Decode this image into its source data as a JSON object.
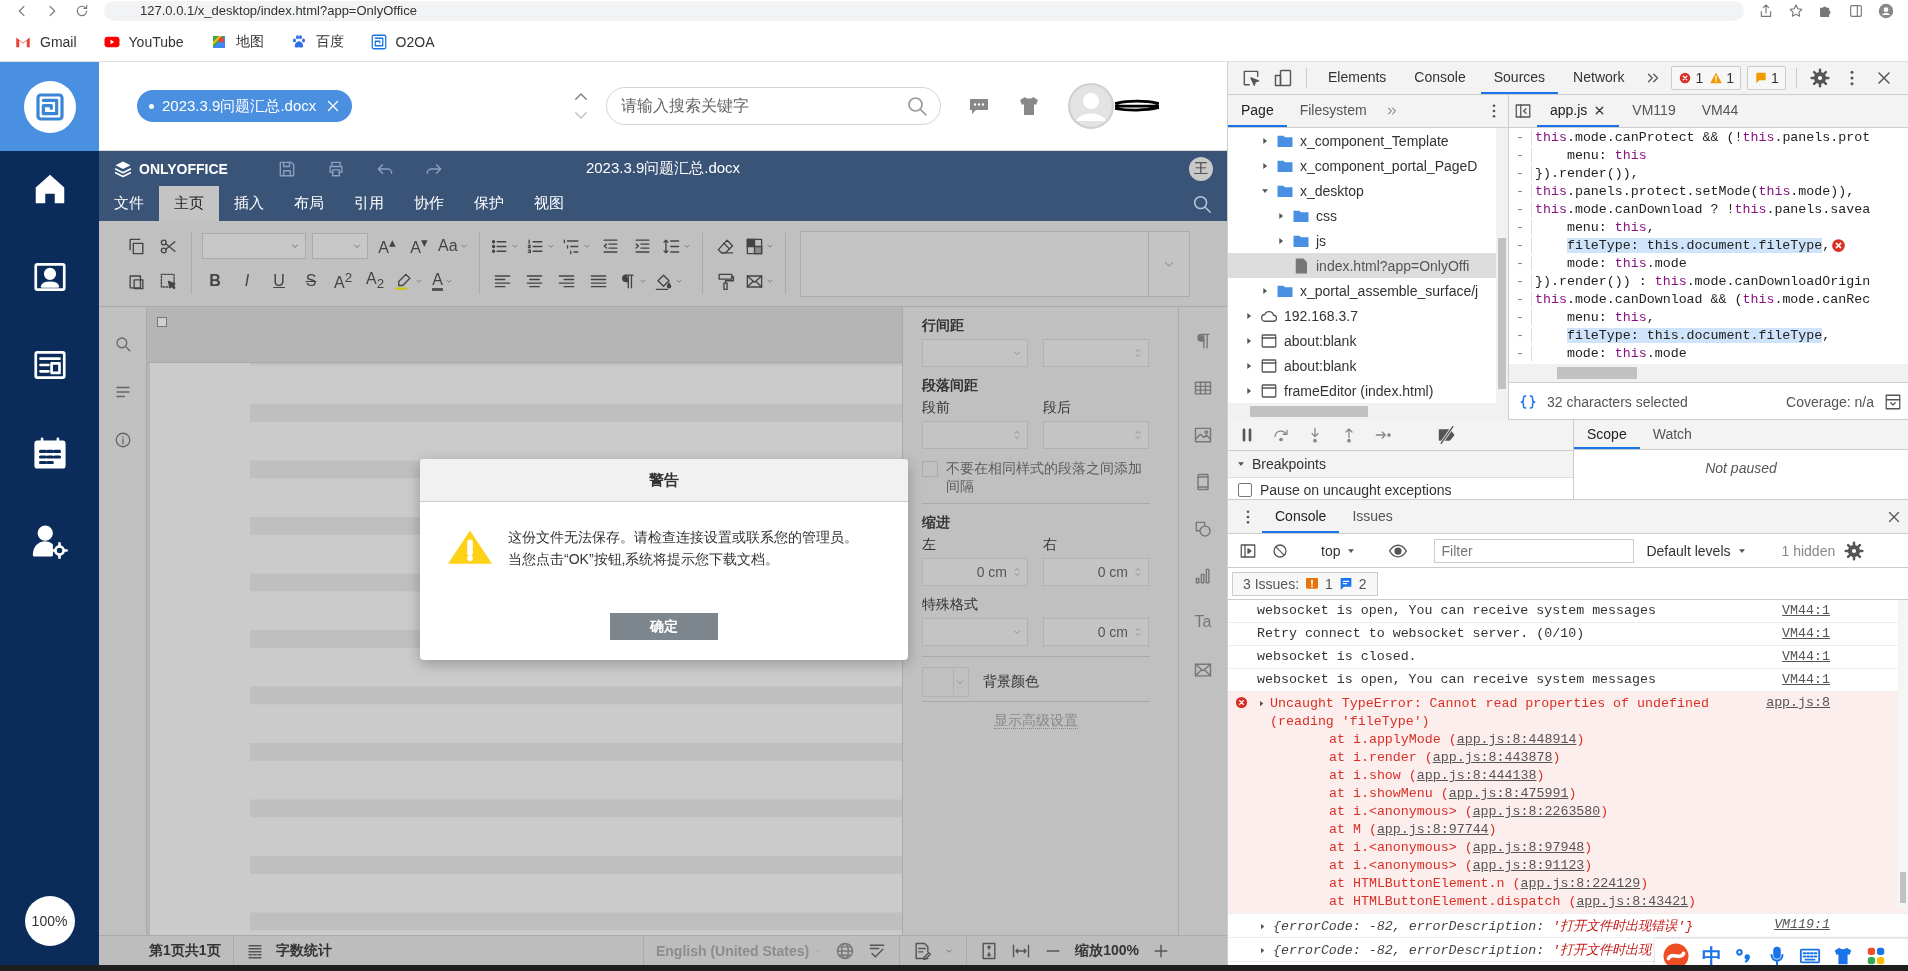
{
  "browser": {
    "url": "127.0.0.1/x_desktop/index.html?app=OnlyOffice",
    "bookmarks": [
      {
        "label": "Gmail"
      },
      {
        "label": "YouTube"
      },
      {
        "label": "地图"
      },
      {
        "label": "百度"
      },
      {
        "label": "O2OA"
      }
    ]
  },
  "app": {
    "zoom_badge": "100%",
    "open_tabs": [
      {
        "label": "2023.3.9问题汇总.docx"
      }
    ],
    "search": {
      "placeholder": "请输入搜索关键字"
    }
  },
  "editor": {
    "brand": "ONLYOFFICE",
    "title": "2023.3.9问题汇总.docx",
    "user_initial": "王",
    "tabs": [
      {
        "label": "文件",
        "selected": false
      },
      {
        "label": "主页",
        "selected": true
      },
      {
        "label": "插入",
        "selected": false
      },
      {
        "label": "布局",
        "selected": false
      },
      {
        "label": "引用",
        "selected": false
      },
      {
        "label": "协作",
        "selected": false
      },
      {
        "label": "保护",
        "selected": false
      },
      {
        "label": "视图",
        "selected": false
      }
    ],
    "glyphs": [
      {
        "text": "A$^{▴}$",
        "kind": "plain"
      },
      {
        "text": "A$^{▾}$",
        "kind": "plain"
      },
      {
        "text": "Aa",
        "kind": "plain"
      },
      {
        "text": "B",
        "kind": "bold"
      },
      {
        "text": "I",
        "kind": "italic"
      },
      {
        "text": "U",
        "kind": "underline"
      },
      {
        "text": "S",
        "kind": "strike"
      },
      {
        "text": "A$^{2}$",
        "kind": "plain"
      },
      {
        "text": "A$_{2}$",
        "kind": "plain"
      },
      {
        "text": "A",
        "kind": "color"
      }
    ],
    "right_bar": {
      "glyph": "Ta"
    },
    "settings": [
      {
        "kind": "heading",
        "text": "行间距"
      },
      {
        "kind": "fields",
        "items": [
          {
            "kind": "select"
          },
          {
            "kind": "spin"
          }
        ]
      },
      {
        "kind": "heading",
        "text": "段落间距"
      },
      {
        "kind": "labels",
        "items": [
          "段前",
          "段后"
        ]
      },
      {
        "kind": "fields",
        "items": [
          {
            "kind": "spin"
          },
          {
            "kind": "spin"
          }
        ]
      },
      {
        "kind": "checkbox",
        "text": "不要在相同样式的段落之间添加间隔",
        "checked": false,
        "disabled": true
      },
      {
        "kind": "divider"
      },
      {
        "kind": "heading",
        "text": "缩进"
      },
      {
        "kind": "labels",
        "items": [
          "左",
          "右"
        ]
      },
      {
        "kind": "fields",
        "items": [
          {
            "kind": "spin",
            "value": "0 cm"
          },
          {
            "kind": "spin",
            "value": "0 cm"
          }
        ]
      },
      {
        "kind": "labels",
        "items": [
          "特殊格式"
        ]
      },
      {
        "kind": "fields",
        "items": [
          {
            "kind": "select"
          },
          {
            "kind": "spin",
            "value": "0 cm"
          }
        ]
      },
      {
        "kind": "divider"
      },
      {
        "kind": "color",
        "text": "背景颜色"
      },
      {
        "kind": "divider"
      },
      {
        "kind": "link",
        "text": "显示高级设置"
      }
    ],
    "status_bar": {
      "page_info": "第1页共1页",
      "word_count": "字数统计",
      "language": {
        "text": "English (United States)",
        "disabled": true
      },
      "zoom": "缩放100%"
    }
  },
  "dialog": {
    "title": "警告",
    "lines": [
      "这份文件无法保存。请检查连接设置或联系您的管理员。",
      "当您点击“OK”按钮,系统将提示您下载文档。"
    ],
    "button": "确定"
  },
  "devtools": {
    "tabs": [
      {
        "label": "Elements",
        "selected": false
      },
      {
        "label": "Console",
        "selected": false
      },
      {
        "label": "Sources",
        "selected": true
      },
      {
        "label": "Network",
        "selected": false
      }
    ],
    "counters": [
      {
        "kind": "error",
        "count": "1"
      },
      {
        "kind": "warning",
        "count": "1"
      },
      {
        "kind": "issue",
        "count": "1"
      }
    ],
    "navigator_tabs": [
      {
        "label": "Page",
        "selected": true
      },
      {
        "label": "Filesystem",
        "selected": false
      }
    ],
    "tree": [
      {
        "kind": "group",
        "children": [
          {
            "label": "x_component_Template",
            "kind": "folder",
            "expanded": false,
            "selected": false
          },
          {
            "label": "x_component_portal_PageD",
            "kind": "folder",
            "expanded": false,
            "selected": false
          },
          {
            "label": "x_desktop",
            "kind": "folder",
            "expanded": true,
            "selected": false,
            "children": [
              {
                "label": "css",
                "kind": "folder",
                "expanded": false,
                "selected": false
              },
              {
                "label": "js",
                "kind": "folder",
                "expanded": false,
                "selected": false
              },
              {
                "label": "index.html?app=OnlyOffi",
                "kind": "file",
                "selected": true
              }
            ]
          },
          {
            "label": "x_portal_assemble_surface/j",
            "kind": "folder",
            "expanded": false,
            "selected": false
          }
        ]
      },
      {
        "label": "192.168.3.7",
        "kind": "cloud",
        "expanded": false,
        "selected": false
      },
      {
        "label": "about:blank",
        "kind": "frame",
        "expanded": false,
        "selected": false
      },
      {
        "label": "about:blank",
        "kind": "frame",
        "expanded": false,
        "selected": false
      },
      {
        "label": "frameEditor (index.html)",
        "kind": "frame",
        "expanded": false,
        "selected": false
      }
    ],
    "editor_tabs": [
      {
        "label": "app.js",
        "selected": true,
        "closable": true
      },
      {
        "label": "VM119",
        "selected": false,
        "closable": false
      },
      {
        "label": "VM44",
        "selected": false,
        "closable": false
      }
    ],
    "code": [
      {
        "gutter": "-",
        "indented": false,
        "error": false,
        "parts": [
          {
            "text": "this",
            "kind": "keyword"
          },
          {
            "text": ".mode.canProtect && (!",
            "kind": "plain"
          },
          {
            "text": "this",
            "kind": "keyword"
          },
          {
            "text": ".panels.prot",
            "kind": "plain"
          }
        ]
      },
      {
        "gutter": "-",
        "indented": true,
        "error": false,
        "parts": [
          {
            "text": "menu: ",
            "kind": "plain"
          },
          {
            "text": "this",
            "kind": "keyword"
          }
        ]
      },
      {
        "gutter": "-",
        "indented": false,
        "error": false,
        "parts": [
          {
            "text": "}).render()),",
            "kind": "plain"
          }
        ]
      },
      {
        "gutter": "-",
        "indented": false,
        "error": false,
        "parts": [
          {
            "text": "this",
            "kind": "keyword"
          },
          {
            "text": ".panels.protect.setMode(",
            "kind": "plain"
          },
          {
            "text": "this",
            "kind": "keyword"
          },
          {
            "text": ".mode)),",
            "kind": "plain"
          }
        ]
      },
      {
        "gutter": "-",
        "indented": false,
        "error": false,
        "parts": [
          {
            "text": "this",
            "kind": "keyword"
          },
          {
            "text": ".mode.canDownload ? !",
            "kind": "plain"
          },
          {
            "text": "this",
            "kind": "keyword"
          },
          {
            "text": ".panels.savea",
            "kind": "plain"
          }
        ]
      },
      {
        "gutter": "-",
        "indented": true,
        "error": false,
        "parts": [
          {
            "text": "menu: ",
            "kind": "plain"
          },
          {
            "text": "this",
            "kind": "keyword"
          },
          {
            "text": ",",
            "kind": "plain"
          }
        ]
      },
      {
        "gutter": "-",
        "indented": true,
        "error": true,
        "parts": [
          {
            "text": "fileType: this.document.fileType",
            "kind": "marked"
          },
          {
            "text": ",",
            "kind": "plain"
          }
        ]
      },
      {
        "gutter": "-",
        "indented": true,
        "error": false,
        "parts": [
          {
            "text": "mode: ",
            "kind": "plain"
          },
          {
            "text": "this",
            "kind": "keyword"
          },
          {
            "text": ".mode",
            "kind": "plain"
          }
        ]
      },
      {
        "gutter": "-",
        "indented": false,
        "error": false,
        "parts": [
          {
            "text": "}).render()) : ",
            "kind": "plain"
          },
          {
            "text": "this",
            "kind": "keyword"
          },
          {
            "text": ".mode.canDownloadOrigin",
            "kind": "plain"
          }
        ]
      },
      {
        "gutter": "-",
        "indented": false,
        "error": false,
        "parts": [
          {
            "text": "this",
            "kind": "keyword"
          },
          {
            "text": ".mode.canDownload && (",
            "kind": "plain"
          },
          {
            "text": "this",
            "kind": "keyword"
          },
          {
            "text": ".mode.canRec",
            "kind": "plain"
          }
        ]
      },
      {
        "gutter": "-",
        "indented": true,
        "error": false,
        "parts": [
          {
            "text": "menu: ",
            "kind": "plain"
          },
          {
            "text": "this",
            "kind": "keyword"
          },
          {
            "text": ",",
            "kind": "plain"
          }
        ]
      },
      {
        "gutter": "-",
        "indented": true,
        "error": false,
        "parts": [
          {
            "text": "fileType: this.document.fileType",
            "kind": "marked"
          },
          {
            "text": ",",
            "kind": "plain"
          }
        ]
      },
      {
        "gutter": "-",
        "indented": true,
        "error": false,
        "parts": [
          {
            "text": "mode: ",
            "kind": "plain"
          },
          {
            "text": "this",
            "kind": "keyword"
          },
          {
            "text": ".mode",
            "kind": "plain"
          }
        ]
      }
    ],
    "selection_status": "32 characters selected",
    "coverage": "Coverage: n/a",
    "sidebar_tabs": [
      {
        "label": "Scope",
        "selected": true
      },
      {
        "label": "Watch",
        "selected": false
      }
    ],
    "not_paused": "Not paused",
    "breakpoints": {
      "label": "Breakpoints",
      "expanded": true
    },
    "pause_exceptions": {
      "label": "Pause on uncaught exceptions",
      "checked": false
    },
    "drawer_tabs": [
      {
        "label": "Console",
        "selected": true
      },
      {
        "label": "Issues",
        "selected": false
      }
    ],
    "context": "top",
    "filter": {
      "placeholder": "Filter"
    },
    "levels": "Default levels",
    "hidden": "1 hidden",
    "issues": {
      "label": "3 Issues:",
      "counts": [
        {
          "kind": "error",
          "count": "1"
        },
        {
          "kind": "info",
          "count": "2"
        }
      ]
    },
    "log": [
      {
        "kind": "log",
        "text": "websocket is open, You can receive system messages",
        "source": "VM44:1"
      },
      {
        "kind": "log",
        "text": "Retry connect to websocket server. (0/10)",
        "source": "VM44:1"
      },
      {
        "kind": "log",
        "text": "websocket is closed.",
        "source": "VM44:1"
      },
      {
        "kind": "log",
        "text": "websocket is open, You can receive system messages",
        "source": "VM44:1"
      },
      {
        "kind": "error",
        "text": "Uncaught TypeError: Cannot read properties of undefined (reading 'fileType')",
        "source": "app.js:8",
        "stack": [
          {
            "text": "at i.applyMode (",
            "link": "app.js:8:448914",
            "end": ")"
          },
          {
            "text": "at i.render (",
            "link": "app.js:8:443878",
            "end": ")"
          },
          {
            "text": "at i.show (",
            "link": "app.js:8:444138",
            "end": ")"
          },
          {
            "text": "at i.showMenu (",
            "link": "app.js:8:475991",
            "end": ")"
          },
          {
            "text": "at i.<anonymous> (",
            "link": "app.js:8:2263580",
            "end": ")"
          },
          {
            "text": "at M (",
            "link": "app.js:8:97744",
            "end": ")"
          },
          {
            "text": "at i.<anonymous> (",
            "link": "app.js:8:97948",
            "end": ")"
          },
          {
            "text": "at i.<anonymous> (",
            "link": "app.js:8:91123",
            "end": ")"
          },
          {
            "text": "at HTMLButtonElement.n (",
            "link": "app.js:8:224129",
            "end": ")"
          },
          {
            "text": "at HTMLButtonElement.dispatch (",
            "link": "app.js:8:43421",
            "end": ")"
          }
        ]
      },
      {
        "kind": "object",
        "text": "{errorCode: -82, errorDescription: ",
        "value": "'打开文件时出现错误'}",
        "source": "VM119:1"
      },
      {
        "kind": "object",
        "text": "{errorCode: -82, errorDescription: ",
        "value": "'打开文件时出现"
      }
    ]
  },
  "ime": {
    "mode": "中"
  }
}
